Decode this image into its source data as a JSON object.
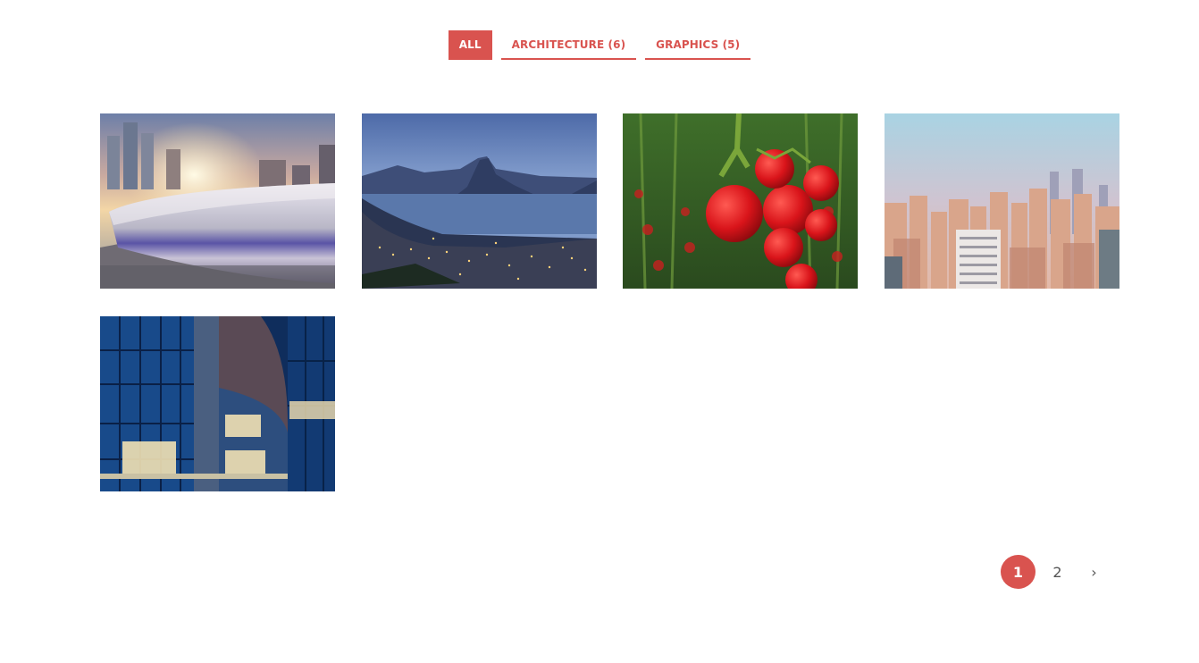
{
  "filters": [
    {
      "label": "ALL",
      "active": true
    },
    {
      "label": "ARCHITECTURE (6)",
      "active": false
    },
    {
      "label": "GRAPHICS (5)",
      "active": false
    }
  ],
  "gallery": {
    "items": [
      {
        "name": "high-speed-train-city-sunset-photo"
      },
      {
        "name": "rio-de-janeiro-bay-night-photo"
      },
      {
        "name": "red-tomatoes-vine-photo"
      },
      {
        "name": "city-skyline-high-rises-photo"
      },
      {
        "name": "glass-office-building-night-photo"
      }
    ]
  },
  "pagination": {
    "pages": [
      "1",
      "2"
    ],
    "current": "1",
    "next_label": "›"
  },
  "colors": {
    "accent": "#d9534f",
    "text_muted": "#555555",
    "background": "#ffffff"
  }
}
